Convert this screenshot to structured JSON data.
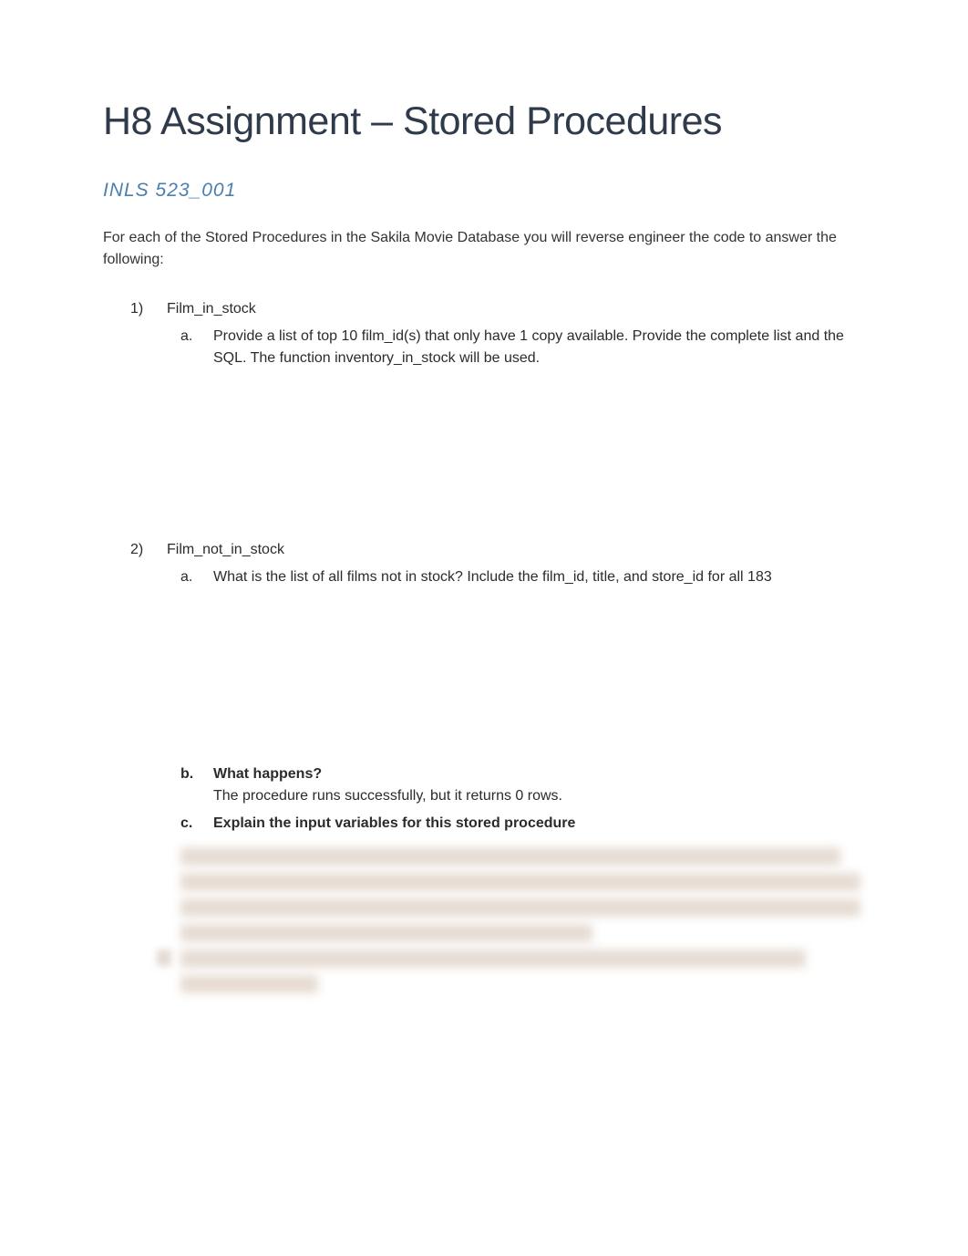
{
  "title": "H8 Assignment – Stored Procedures",
  "subtitle": "INLS 523_001",
  "intro": "For each of the Stored Procedures in the Sakila Movie Database you will reverse engineer the code to answer the following:",
  "items": [
    {
      "num": "1)",
      "label": "Film_in_stock",
      "subs": [
        {
          "letter": "a.",
          "text": "Provide a list of top 10 film_id(s) that only have 1 copy available. Provide the complete list and the SQL. The function inventory_in_stock will be used."
        }
      ]
    },
    {
      "num": "2)",
      "label": "Film_not_in_stock",
      "subs": [
        {
          "letter": "a.",
          "text": "What is the list of all films not in stock? Include the film_id, title, and store_id for all 183"
        },
        {
          "letter": "b.",
          "bold_label": "What happens?",
          "text": "The procedure runs successfully, but it returns 0 rows."
        },
        {
          "letter": "c.",
          "bold_label": "Explain the input variables for this stored procedure"
        }
      ]
    }
  ]
}
